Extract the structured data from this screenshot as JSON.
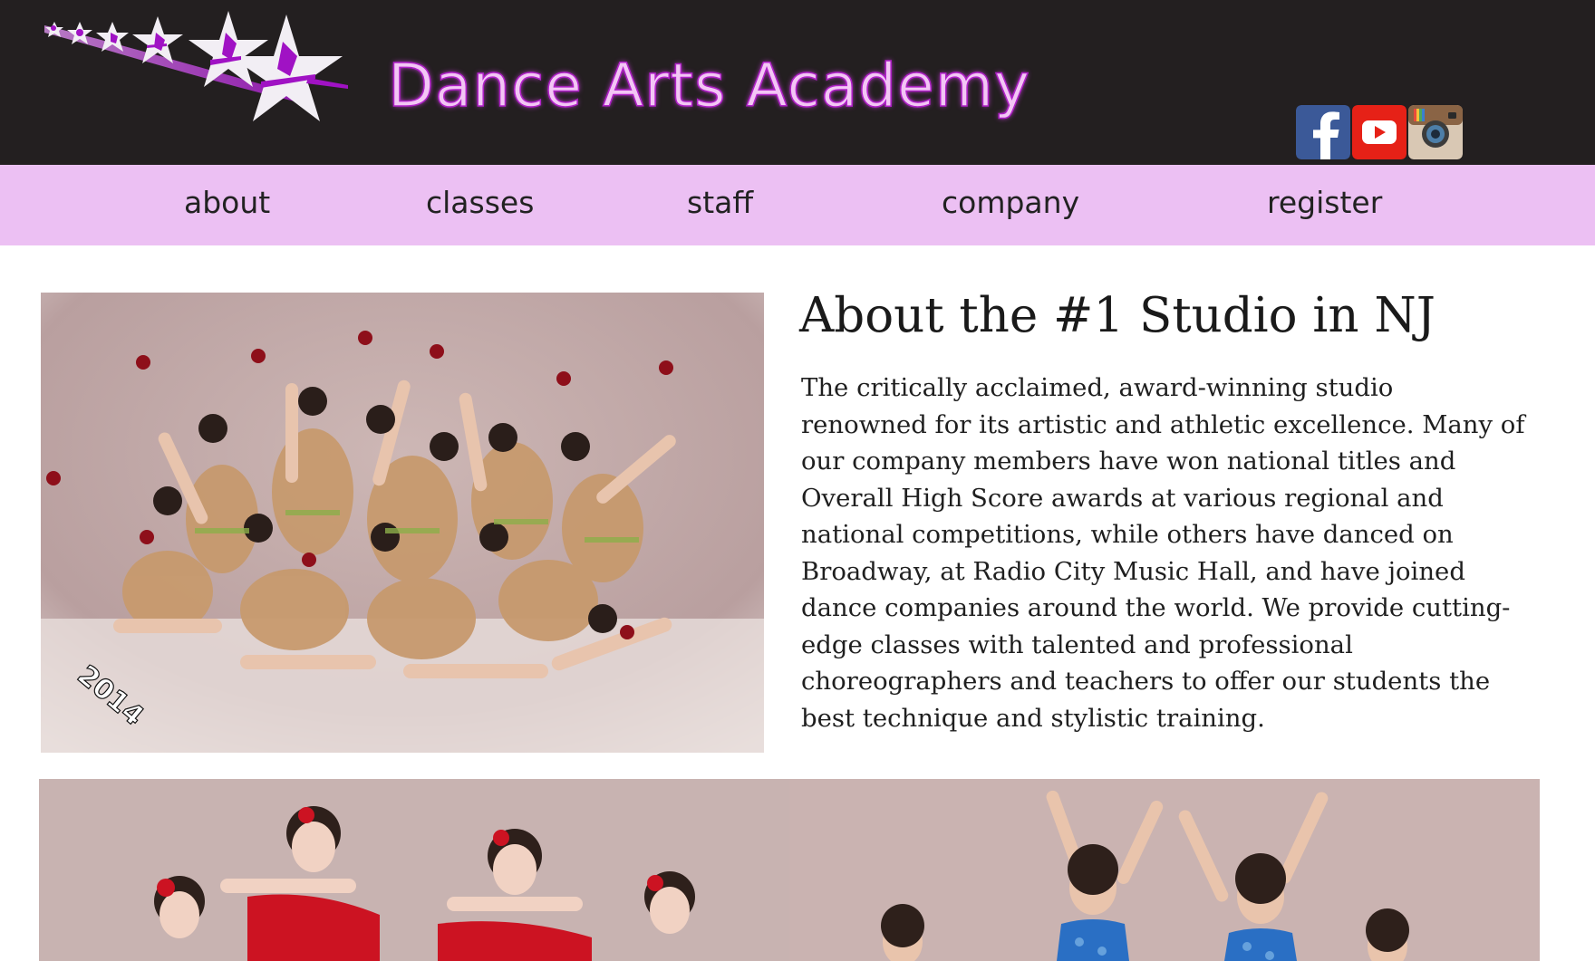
{
  "header": {
    "site_title": "Dance Arts Academy",
    "logo_icon": "dancing-stars-logo-icon",
    "social": [
      {
        "name": "facebook-icon",
        "color": "#3b5998"
      },
      {
        "name": "youtube-icon",
        "color": "#e62117"
      },
      {
        "name": "instagram-icon",
        "color": "#a07e5f"
      }
    ]
  },
  "nav": {
    "items": [
      {
        "label": "about"
      },
      {
        "label": "classes"
      },
      {
        "label": "staff"
      },
      {
        "label": "company"
      },
      {
        "label": "register"
      }
    ]
  },
  "main": {
    "about_title": "About the #1 Studio in NJ",
    "about_body": "The critically acclaimed, award-winning studio renowned for its artistic and athletic excellence. Many of our company members have won national titles and Overall High Score awards at various regional and national competitions, while others have danced on Broadway, at Radio City Music Hall, and have joined dance companies around the world. We provide cutting-edge classes with talented and professional choreographers and teachers to offer our students the best technique and stylistic training.",
    "photo_year": "2014"
  },
  "colors": {
    "header_bg": "#231f20",
    "nav_bg": "#ecc0f3",
    "title_fill": "#f3c6f5",
    "brand_purple": "#b020c8"
  }
}
